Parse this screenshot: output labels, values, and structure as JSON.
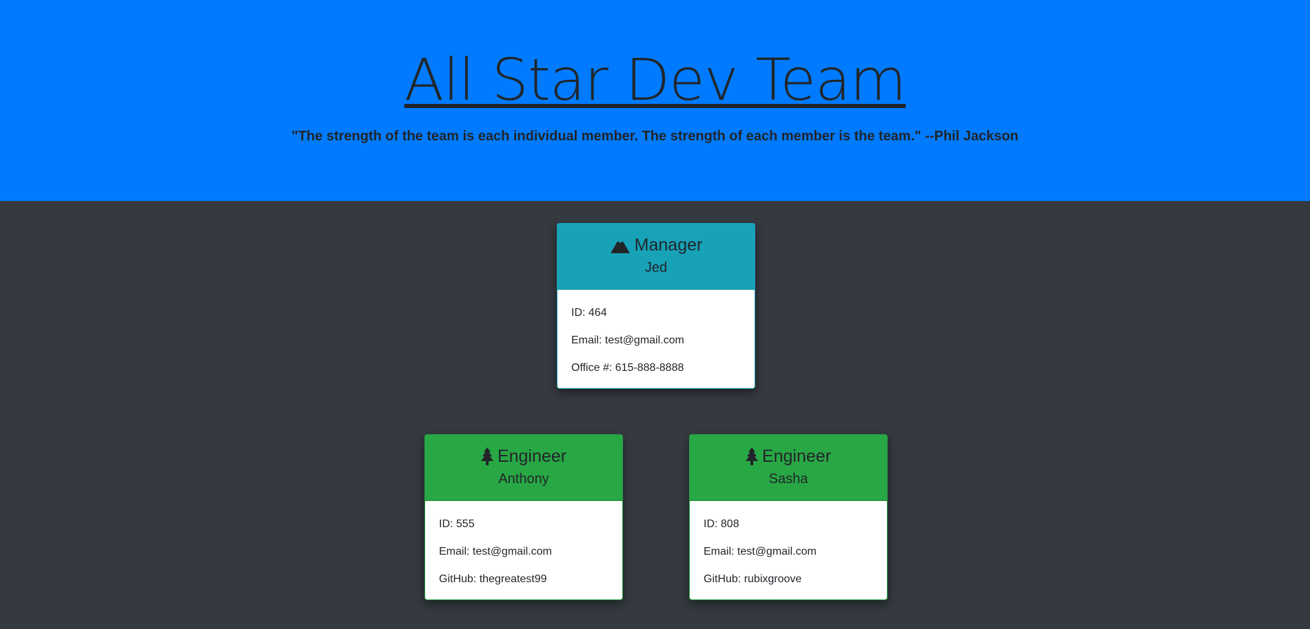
{
  "header": {
    "title": "All Star Dev Team",
    "quote": "\"The strength of the team is each individual member. The strength of each member is the team.\" --Phil Jackson"
  },
  "colors": {
    "header_bg": "#007bff",
    "page_bg": "#343a40",
    "manager_header": "#17a2b8",
    "engineer_header": "#28a745"
  },
  "manager": {
    "icon": "mountain-icon",
    "role": "Manager",
    "name": "Jed",
    "id": "ID: 464",
    "email": "Email: test@gmail.com",
    "office": "Office #: 615-888-8888"
  },
  "engineers": [
    {
      "icon": "tree-icon",
      "role": "Engineer",
      "name": "Anthony",
      "id": "ID: 555",
      "email": "Email: test@gmail.com",
      "github": "GitHub: thegreatest99"
    },
    {
      "icon": "tree-icon",
      "role": "Engineer",
      "name": "Sasha",
      "id": "ID: 808",
      "email": "Email: test@gmail.com",
      "github": "GitHub: rubixgroove"
    }
  ]
}
